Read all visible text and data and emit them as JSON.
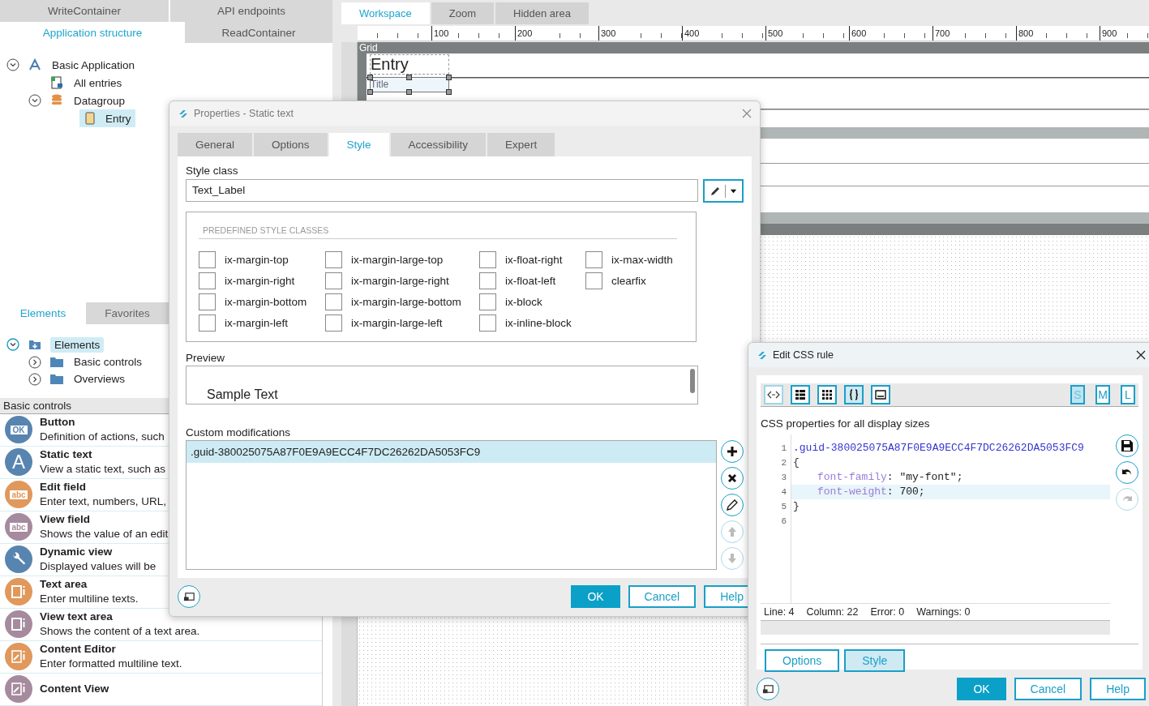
{
  "left_panel": {
    "tab_rows": [
      [
        {
          "label": "WriteContainer",
          "selected": false
        },
        {
          "label": "API endpoints",
          "selected": false
        }
      ],
      [
        {
          "label": "Application structure",
          "selected": true
        },
        {
          "label": "ReadContainer",
          "selected": false
        }
      ]
    ],
    "structure_tree": [
      {
        "label": "Basic Application",
        "kind": "app",
        "expanded": true,
        "selected": false,
        "children": [
          {
            "label": "All entries",
            "kind": "list",
            "selected": false
          },
          {
            "label": "Datagroup",
            "kind": "database",
            "expanded": true,
            "selected": false,
            "children": [
              {
                "label": "Entry",
                "kind": "entry",
                "selected": true
              }
            ]
          }
        ]
      }
    ],
    "element_tabs": [
      {
        "label": "Elements",
        "selected": true
      },
      {
        "label": "Favorites",
        "selected": false
      }
    ],
    "element_tree": [
      {
        "label": "Elements",
        "kind": "box",
        "expanded": true,
        "selected": true,
        "children": [
          {
            "label": "Basic controls",
            "kind": "folder",
            "expanded": false,
            "selected": false
          },
          {
            "label": "Overviews",
            "kind": "folder",
            "expanded": false,
            "selected": false
          }
        ]
      }
    ],
    "section_title": "Basic controls",
    "controls": [
      {
        "name": "Button",
        "description": "Definition of actions, such",
        "kind": "ok",
        "icon_text": "OK",
        "color": "#5884b0"
      },
      {
        "name": "Static text",
        "description": "View a static text, such as",
        "kind": "letter",
        "icon_text": "A",
        "color": "#5884b0"
      },
      {
        "name": "Edit field",
        "description": "Enter text, numbers, URL,",
        "kind": "abc",
        "icon_text": "abc",
        "color": "#e0985c"
      },
      {
        "name": "View field",
        "description": "Shows the value of an edit",
        "kind": "abc",
        "icon_text": "abc",
        "color": "#a68a9d"
      },
      {
        "name": "Dynamic view",
        "description": "Displayed values will be",
        "kind": "wrench",
        "color": "#5884b0"
      },
      {
        "name": "Text area",
        "description": "Enter multiline texts.",
        "kind": "textarea",
        "color": "#e0985c"
      },
      {
        "name": "View text area",
        "description": "Shows the content of a text area.",
        "kind": "textarea",
        "color": "#a68a9d"
      },
      {
        "name": "Content Editor",
        "description": "Enter formatted multiline text.",
        "kind": "editor",
        "color": "#e0985c"
      },
      {
        "name": "Content View",
        "kind": "editor",
        "color": "#a68a9d"
      }
    ]
  },
  "workspace": {
    "tabs": [
      {
        "label": "Workspace",
        "selected": true
      },
      {
        "label": "Zoom",
        "selected": false
      },
      {
        "label": "Hidden area",
        "selected": false
      }
    ],
    "ruler_labels": [
      "100",
      "200",
      "300",
      "400",
      "500",
      "600",
      "700",
      "800",
      "900"
    ],
    "grid_label": "Grid",
    "entry_label": "Entry",
    "title_field": {
      "text": "Title",
      "selected": true
    }
  },
  "properties_dialog": {
    "title": "Properties - Static text",
    "tabs": [
      {
        "label": "General",
        "selected": false
      },
      {
        "label": "Options",
        "selected": false
      },
      {
        "label": "Style",
        "selected": true
      },
      {
        "label": "Accessibility",
        "selected": false
      },
      {
        "label": "Expert",
        "selected": false
      }
    ],
    "style_class_label": "Style class",
    "style_class_value": "Text_Label",
    "predefined_heading": "PREDEFINED STYLE CLASSES",
    "class_columns": [
      [
        {
          "label": "ix-margin-top",
          "checked": false
        },
        {
          "label": "ix-margin-right",
          "checked": false
        },
        {
          "label": "ix-margin-bottom",
          "checked": false
        },
        {
          "label": "ix-margin-left",
          "checked": false
        }
      ],
      [
        {
          "label": "ix-margin-large-top",
          "checked": false
        },
        {
          "label": "ix-margin-large-right",
          "checked": false
        },
        {
          "label": "ix-margin-large-bottom",
          "checked": false
        },
        {
          "label": "ix-margin-large-left",
          "checked": false
        }
      ],
      [
        {
          "label": "ix-float-right",
          "checked": false
        },
        {
          "label": "ix-float-left",
          "checked": false
        },
        {
          "label": "ix-block",
          "checked": false
        },
        {
          "label": "ix-inline-block",
          "checked": false
        }
      ],
      [
        {
          "label": "ix-max-width",
          "checked": false
        },
        {
          "label": "clearfix",
          "checked": false
        }
      ]
    ],
    "preview_label": "Preview",
    "preview_text": "Sample Text",
    "custom_label": "Custom modifications",
    "custom_rows": [
      {
        "text": ".guid-380025075A87F0E9A9ECC4F7DC26262DA5053FC9",
        "selected": true
      }
    ],
    "side_buttons": [
      {
        "kind": "add",
        "disabled": false
      },
      {
        "kind": "delete",
        "disabled": false
      },
      {
        "kind": "edit",
        "disabled": false
      },
      {
        "kind": "up",
        "disabled": true
      },
      {
        "kind": "down",
        "disabled": true
      }
    ],
    "buttons": [
      {
        "label": "OK",
        "kind": "primary"
      },
      {
        "label": "Cancel",
        "kind": "secondary"
      },
      {
        "label": "Help",
        "kind": "secondary"
      }
    ]
  },
  "css_dialog": {
    "title": "Edit CSS rule",
    "tools": [
      {
        "kind": "code",
        "selected": true
      },
      {
        "kind": "list",
        "selected": false
      },
      {
        "kind": "grid",
        "selected": false
      },
      {
        "kind": "braces",
        "selected": true
      },
      {
        "kind": "panel",
        "selected": false
      }
    ],
    "sizes": [
      {
        "label": "S",
        "selected": true
      },
      {
        "label": "M",
        "selected": false
      },
      {
        "label": "L",
        "selected": false
      }
    ],
    "heading": "CSS properties for all display sizes",
    "code_lines": [
      {
        "number": "1",
        "current": false,
        "indented": false,
        "tokens": [
          {
            "kind": "selector",
            "text": ".guid-380025075A87F0E9A9ECC4F7DC26262DA5053FC9"
          }
        ]
      },
      {
        "number": "2",
        "current": false,
        "indented": false,
        "tokens": [
          {
            "kind": "punct",
            "text": "{"
          }
        ]
      },
      {
        "number": "3",
        "current": false,
        "indented": true,
        "tokens": [
          {
            "kind": "property",
            "text": "font-family"
          },
          {
            "kind": "punct",
            "text": ": "
          },
          {
            "kind": "value",
            "text": "\"my-font\""
          },
          {
            "kind": "punct",
            "text": ";"
          }
        ]
      },
      {
        "number": "4",
        "current": true,
        "indented": true,
        "tokens": [
          {
            "kind": "property",
            "text": "font-weight"
          },
          {
            "kind": "punct",
            "text": ": "
          },
          {
            "kind": "value",
            "text": "700"
          },
          {
            "kind": "punct",
            "text": ";"
          }
        ]
      },
      {
        "number": "5",
        "current": false,
        "indented": false,
        "tokens": [
          {
            "kind": "punct",
            "text": "}"
          }
        ]
      },
      {
        "number": "6"
      }
    ],
    "side_buttons": [
      {
        "kind": "save",
        "disabled": false
      },
      {
        "kind": "undo",
        "disabled": false
      },
      {
        "kind": "redo",
        "disabled": true
      }
    ],
    "status": [
      "Line: 4",
      "Column: 22",
      "Error: 0",
      "Warnings: 0"
    ],
    "tabs": [
      {
        "label": "Options",
        "selected": false
      },
      {
        "label": "Style",
        "selected": true
      }
    ],
    "buttons": [
      {
        "label": "OK",
        "kind": "primary"
      },
      {
        "label": "Cancel",
        "kind": "secondary"
      },
      {
        "label": "Help",
        "kind": "secondary"
      }
    ]
  }
}
